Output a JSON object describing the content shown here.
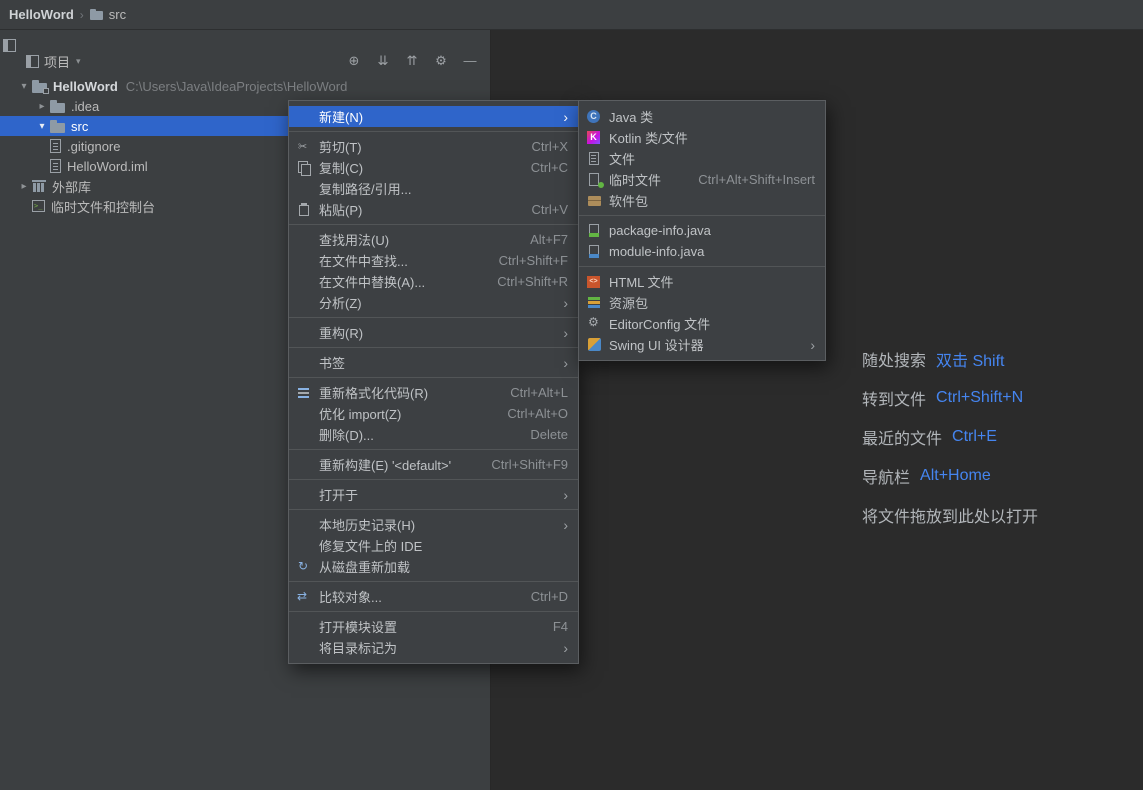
{
  "colors": {
    "panel_bg": "#3c3f41",
    "editor_bg": "#2b2b2b",
    "selection_blue": "#2f65ca",
    "shortcut_blue": "#4585f0",
    "text": "#bbbbbb",
    "muted_text": "#8d9195"
  },
  "breadcrumb": {
    "project": "HelloWord",
    "separator": "›",
    "item": "src",
    "item_icon": "folder"
  },
  "project_panel": {
    "title": "项目",
    "title_chevron": "▾",
    "header_icons": [
      "locate",
      "expand-all",
      "collapse-all",
      "settings-gear",
      "hide"
    ],
    "tree": [
      {
        "label": "HelloWord",
        "path": "C:\\Users\\Java\\IdeaProjects\\HelloWord",
        "icon": "project-folder",
        "state": "expanded",
        "level": 0
      },
      {
        "label": ".idea",
        "icon": "folder",
        "state": "collapsed",
        "level": 1
      },
      {
        "label": "src",
        "icon": "folder",
        "state": "expanded",
        "level": 1,
        "selected": true
      },
      {
        "label": ".gitignore",
        "icon": "file",
        "level": 1
      },
      {
        "label": "HelloWord.iml",
        "icon": "file",
        "level": 1
      },
      {
        "label": "外部库",
        "icon": "external-libraries",
        "state": "collapsed",
        "level": 0
      },
      {
        "label": "临时文件和控制台",
        "icon": "scratches-console",
        "level": 0
      }
    ]
  },
  "context_menu": {
    "items": [
      {
        "label": "新建(N)",
        "submenu": true,
        "selected": true
      },
      {
        "separator": true
      },
      {
        "label": "剪切(T)",
        "shortcut": "Ctrl+X",
        "icon": "cut"
      },
      {
        "label": "复制(C)",
        "shortcut": "Ctrl+C",
        "icon": "copy"
      },
      {
        "label": "复制路径/引用...",
        "shortcut": ""
      },
      {
        "label": "粘贴(P)",
        "shortcut": "Ctrl+V",
        "icon": "paste"
      },
      {
        "separator": true
      },
      {
        "label": "查找用法(U)",
        "shortcut": "Alt+F7"
      },
      {
        "label": "在文件中查找...",
        "shortcut": "Ctrl+Shift+F"
      },
      {
        "label": "在文件中替换(A)...",
        "shortcut": "Ctrl+Shift+R"
      },
      {
        "label": "分析(Z)",
        "submenu": true
      },
      {
        "separator": true
      },
      {
        "label": "重构(R)",
        "submenu": true
      },
      {
        "separator": true
      },
      {
        "label": "书签",
        "submenu": true
      },
      {
        "separator": true
      },
      {
        "label": "重新格式化代码(R)",
        "shortcut": "Ctrl+Alt+L",
        "icon": "reformat-code"
      },
      {
        "label": "优化 import(Z)",
        "shortcut": "Ctrl+Alt+O"
      },
      {
        "label": "删除(D)...",
        "shortcut": "Delete"
      },
      {
        "separator": true
      },
      {
        "label": "重新构建(E) '<default>'",
        "shortcut": "Ctrl+Shift+F9"
      },
      {
        "separator": true
      },
      {
        "label": "打开于",
        "submenu": true
      },
      {
        "separator": true
      },
      {
        "label": "本地历史记录(H)",
        "submenu": true
      },
      {
        "label": "修复文件上的 IDE",
        "shortcut": ""
      },
      {
        "label": "从磁盘重新加载",
        "shortcut": "",
        "icon": "reload-from-disk"
      },
      {
        "separator": true
      },
      {
        "label": "比较对象...",
        "shortcut": "Ctrl+D",
        "icon": "compare"
      },
      {
        "separator": true
      },
      {
        "label": "打开模块设置",
        "shortcut": "F4"
      },
      {
        "label": "将目录标记为",
        "submenu": true
      }
    ]
  },
  "new_submenu": {
    "items": [
      {
        "label": "Java 类",
        "icon": "java-class"
      },
      {
        "label": "Kotlin 类/文件",
        "icon": "kotlin"
      },
      {
        "label": "文件",
        "icon": "file"
      },
      {
        "label": "临时文件",
        "shortcut": "Ctrl+Alt+Shift+Insert",
        "icon": "scratch-file"
      },
      {
        "label": "软件包",
        "icon": "package"
      },
      {
        "separator": true
      },
      {
        "label": "package-info.java",
        "icon": "package-info"
      },
      {
        "label": "module-info.java",
        "icon": "module-info"
      },
      {
        "separator": true
      },
      {
        "label": "HTML 文件",
        "icon": "html-file"
      },
      {
        "label": "资源包",
        "icon": "resource-bundle"
      },
      {
        "label": "EditorConfig 文件",
        "icon": "editorconfig"
      },
      {
        "label": "Swing UI 设计器",
        "icon": "swing-designer",
        "submenu": true
      }
    ]
  },
  "editor_hints": {
    "lines": [
      {
        "label": "随处搜索",
        "shortcut": "双击 Shift"
      },
      {
        "label": "转到文件",
        "shortcut": "Ctrl+Shift+N"
      },
      {
        "label": "最近的文件",
        "shortcut": "Ctrl+E"
      },
      {
        "label": "导航栏",
        "shortcut": "Alt+Home"
      },
      {
        "label": "将文件拖放到此处以打开",
        "shortcut": ""
      }
    ]
  }
}
